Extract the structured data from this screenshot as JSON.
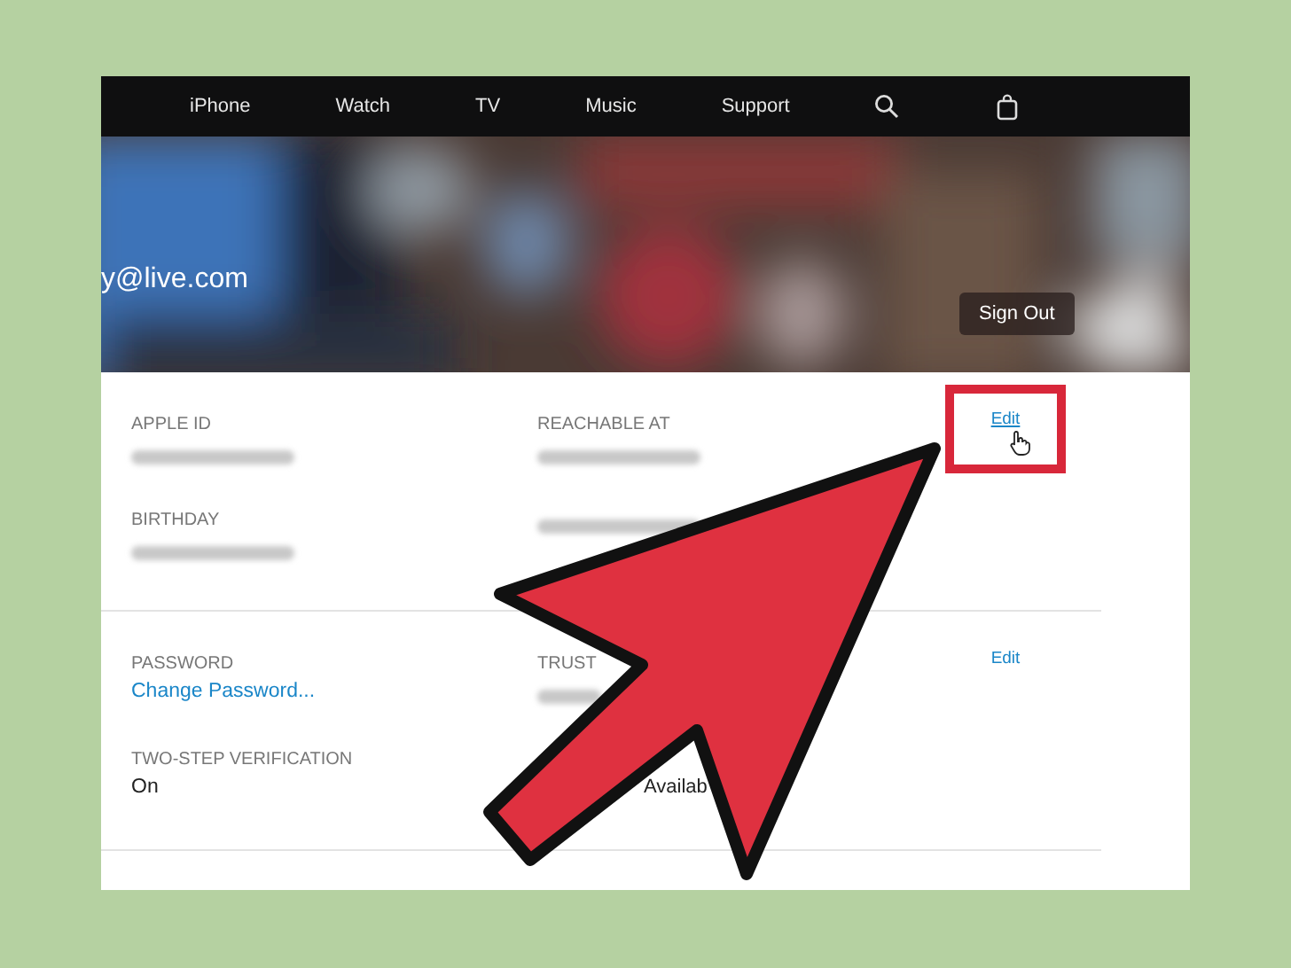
{
  "nav": {
    "items": [
      "iPhone",
      "Watch",
      "TV",
      "Music",
      "Support"
    ]
  },
  "hero": {
    "kind": "picture",
    "email": "y@live.com",
    "sign_out": "Sign Out"
  },
  "sections": [
    {
      "edit": "Edit",
      "highlighted": true,
      "columns": [
        [
          {
            "label": "APPLE ID",
            "kind": "blurred"
          },
          {
            "label": "BIRTHDAY",
            "kind": "blurred"
          }
        ],
        [
          {
            "label": "REACHABLE AT",
            "kind": "blurred"
          },
          {
            "kind": "blurred"
          }
        ]
      ]
    },
    {
      "edit": "Edit",
      "highlighted": false,
      "columns": [
        [
          {
            "label": "PASSWORD",
            "kind": "link",
            "value": "Change Password..."
          },
          {
            "label": "TWO-STEP VERIFICATION",
            "kind": "text",
            "value": "On"
          }
        ],
        [
          {
            "label": "TRUST",
            "kind": "blurred"
          },
          {
            "kind": "covered-text",
            "value": "Availab"
          }
        ]
      ]
    }
  ]
}
